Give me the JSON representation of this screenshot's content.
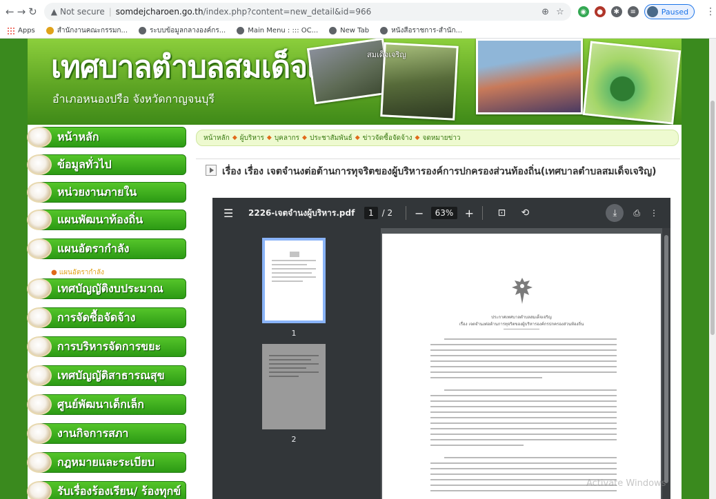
{
  "browser": {
    "url_warning": "Not secure",
    "url_host": "somdejcharoen.go.th",
    "url_path": "/index.php?content=new_detail&id=966",
    "profile_status": "Paused",
    "bookmarks": [
      {
        "label": "Apps"
      },
      {
        "label": "สำนักงานคณะกรรมก..."
      },
      {
        "label": "ระบบข้อมูลกลางองค์กร..."
      },
      {
        "label": "Main Menu : ::: OC..."
      },
      {
        "label": "New Tab"
      },
      {
        "label": "หนังสือราชการ-สำนัก..."
      }
    ]
  },
  "banner": {
    "title": "เทศบาลตำบลสมเด็จเจริญ",
    "subtitle": "อำเภอหนองปรือ  จังหวัดกาญจนบุรี",
    "seal_text": "สมเด็จเจริญ"
  },
  "sidebar": {
    "items": [
      {
        "label": "หน้าหลัก"
      },
      {
        "label": "ข้อมูลทั่วไป"
      },
      {
        "label": "หน่วยงานภายใน"
      },
      {
        "label": "แผนพัฒนาท้องถิ่น"
      },
      {
        "label": "แผนอัตรากำลัง"
      },
      {
        "label": "เทศบัญญัติงบประมาณ"
      },
      {
        "label": "การจัดซื้อจัดจ้าง"
      },
      {
        "label": "การบริหารจัดการขยะ"
      },
      {
        "label": "เทศบัญญัติสาธารณสุข"
      },
      {
        "label": "ศูนย์พัฒนาเด็กเล็ก"
      },
      {
        "label": "งานกิจการสภา"
      },
      {
        "label": "กฎหมายและระเบียบ"
      },
      {
        "label": "รับเรื่องร้องเรียน/ ร้องทุกข์"
      }
    ],
    "sub_item": "แผนอัตรากำลัง"
  },
  "breadcrumb": {
    "items": [
      "หน้าหลัก",
      "ผู้บริหาร",
      "บุคลากร",
      "ประชาสัมพันธ์",
      "ข่าวจัดซื้อจัดจ้าง",
      "จดหมายข่าว"
    ]
  },
  "article": {
    "title": "เรื่อง เรื่อง เจตจำนงต่อต้านการทุจริตของผู้บริหารองค์การปกครองส่วนท้องถิ่น(เทศบาลตำบลสมเด็จเจริญ)"
  },
  "pdf": {
    "filename": "2226-เจตจำนงผู้บริหาร.pdf",
    "current_page": "1",
    "total_pages": "/ 2",
    "zoom": "63%",
    "thumbnails": [
      {
        "num": "1"
      },
      {
        "num": "2"
      }
    ],
    "doc_heading_1": "ประกาศเทศบาลตำบลสมเด็จเจริญ",
    "doc_heading_2": "เรื่อง เจตจำนงต่อต้านการทุจริตของผู้บริหารองค์กรปกครองส่วนท้องถิ่น"
  },
  "os_watermark": "Activate Windows",
  "colors": {
    "page_green": "#3a8a1e",
    "menu_green": "#2c9a14",
    "pdf_toolbar": "#323639",
    "pdf_bg": "#525659",
    "accent_blue": "#8ab4f8"
  }
}
